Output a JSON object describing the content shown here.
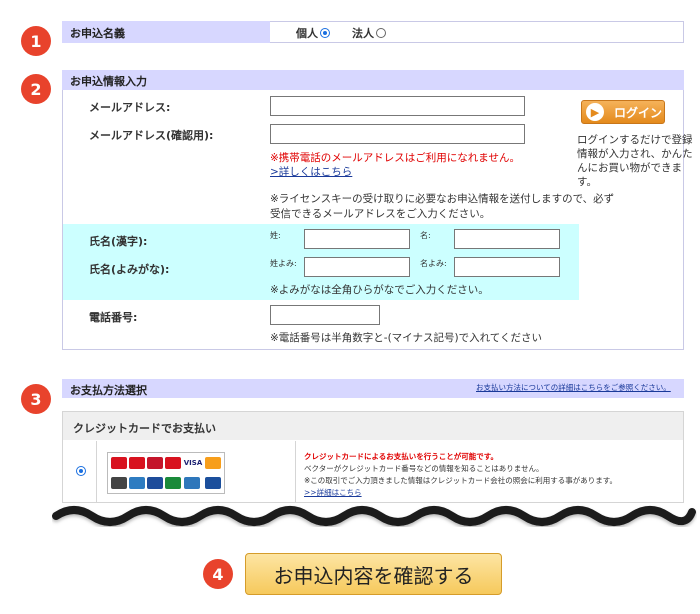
{
  "steps": [
    "1",
    "2",
    "3",
    "4"
  ],
  "section1": {
    "title": "お申込名義",
    "opt_individual": "個人",
    "opt_corporate": "法人"
  },
  "section2": {
    "title": "お申込情報入力",
    "email_label": "メールアドレス:",
    "email_confirm_label": "メールアドレス(確認用):",
    "mobile_warning": "※携帯電話のメールアドレスはご利用になれません。",
    "details_link": ">詳しくはこちら",
    "license_note_1": "※ライセンスキーの受け取りに必要なお申込情報を送付しますので、必ず",
    "license_note_2": "受信できるメールアドレスをご入力ください。",
    "name_kanji_label": "氏名(漢字):",
    "name_kana_label": "氏名(よみがな):",
    "sei": "姓:",
    "mei": "名:",
    "sei_yomi": "姓よみ:",
    "mei_yomi": "名よみ:",
    "kana_note": "※よみがなは全角ひらがなでご入力ください。",
    "phone_label": "電話番号:",
    "phone_note": "※電話番号は半角数字と-(マイナス記号)で入れてください",
    "login_label": "ログイン",
    "login_note_1": "ログインするだけで登録",
    "login_note_2": "情報が入力され、かんた",
    "login_note_3": "んにお買い物ができま",
    "login_note_4": "す。"
  },
  "section3": {
    "title": "お支払方法選択",
    "details_link": "お支払い方法についての詳細はこちらをご参照ください。",
    "credit_title": "クレジットカードでお支払い",
    "credit_note_1": "クレジットカードによるお支払いを行うことが可能です。",
    "credit_note_2": "ベクターがクレジットカード番号などの情報を知ることはありません。",
    "credit_note_3": "※この取引でご入力頂きました情報はクレジットカード会社の照会に利用する事があります。",
    "credit_link": ">>詳細はこちら",
    "card_visa": "VISA"
  },
  "confirm_label": "お申込内容を確認する",
  "colors": {
    "step_badge": "#e8432c",
    "section_header": "#d7d7ff",
    "name_area": "#ccffff",
    "warning": "#e00000",
    "button": "#f6c95c"
  }
}
